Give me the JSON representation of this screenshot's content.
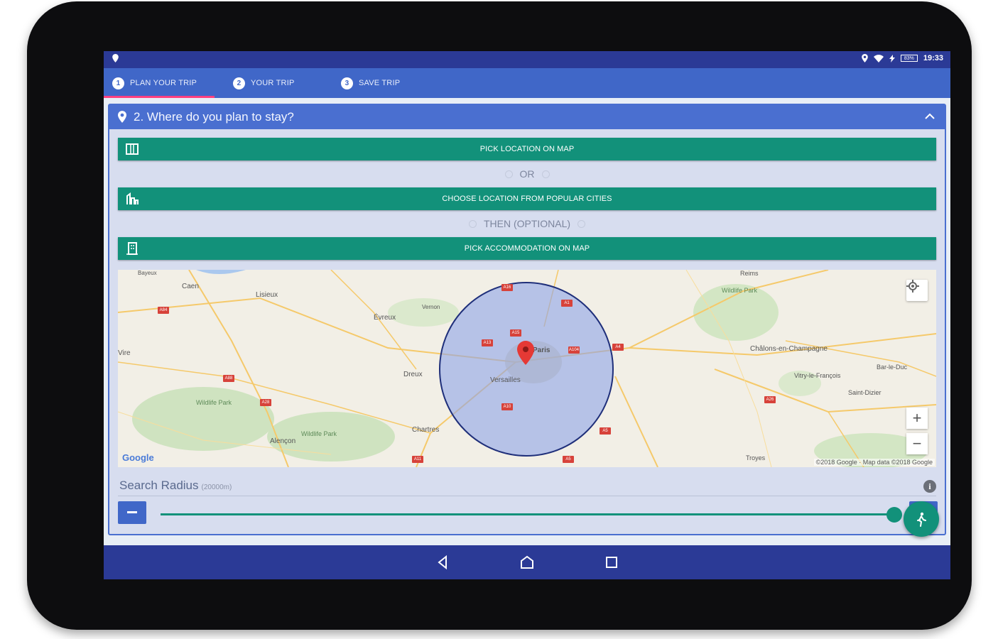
{
  "statusbar": {
    "time": "19:33",
    "battery": "83%"
  },
  "tabs": [
    {
      "num": "1",
      "label": "PLAN YOUR TRIP",
      "active": true
    },
    {
      "num": "2",
      "label": "YOUR TRIP",
      "active": false
    },
    {
      "num": "3",
      "label": "SAVE TRIP",
      "active": false
    }
  ],
  "card": {
    "title": "2. Where do you plan to stay?",
    "pick_location_label": "PICK LOCATION ON MAP",
    "or_label": "OR",
    "choose_city_label": "CHOOSE LOCATION FROM POPULAR CITIES",
    "then_label": "THEN (OPTIONAL)",
    "pick_accommodation_label": "PICK ACCOMMODATION ON MAP"
  },
  "map": {
    "labels": {
      "caen": "Caen",
      "lisieux": "Lisieux",
      "evreux": "Évreux",
      "dreux": "Dreux",
      "chartres": "Chartres",
      "versailles": "Versailles",
      "paris": "Paris",
      "alencon": "Alençon",
      "chalons": "Châlons-en-Champagne",
      "vitry": "Vitry-le-François",
      "saint_dizier": "Saint-Dizier",
      "bar_le_duc": "Bar-le-Duc",
      "reims": "Reims",
      "troyes": "Troyes",
      "vire": "Vire",
      "wildlife_park_1": "Wildlife Park",
      "wildlife_park_2": "Wildlife Park",
      "wildlife_park_3": "Wildlife Park",
      "bayeux": "Bayeux",
      "vernon": "Vernon"
    },
    "google": "Google",
    "attribution": "©2018 Google · Map data ©2018 Google",
    "zoom_in": "+",
    "zoom_out": "−"
  },
  "radius": {
    "label": "Search Radius",
    "unit": "(20000m)",
    "info": "i",
    "value_fraction": 1.0
  },
  "colors": {
    "primary": "#4067c8",
    "dark": "#2b3a96",
    "accent": "#12917a",
    "indicator": "#ff4081"
  }
}
